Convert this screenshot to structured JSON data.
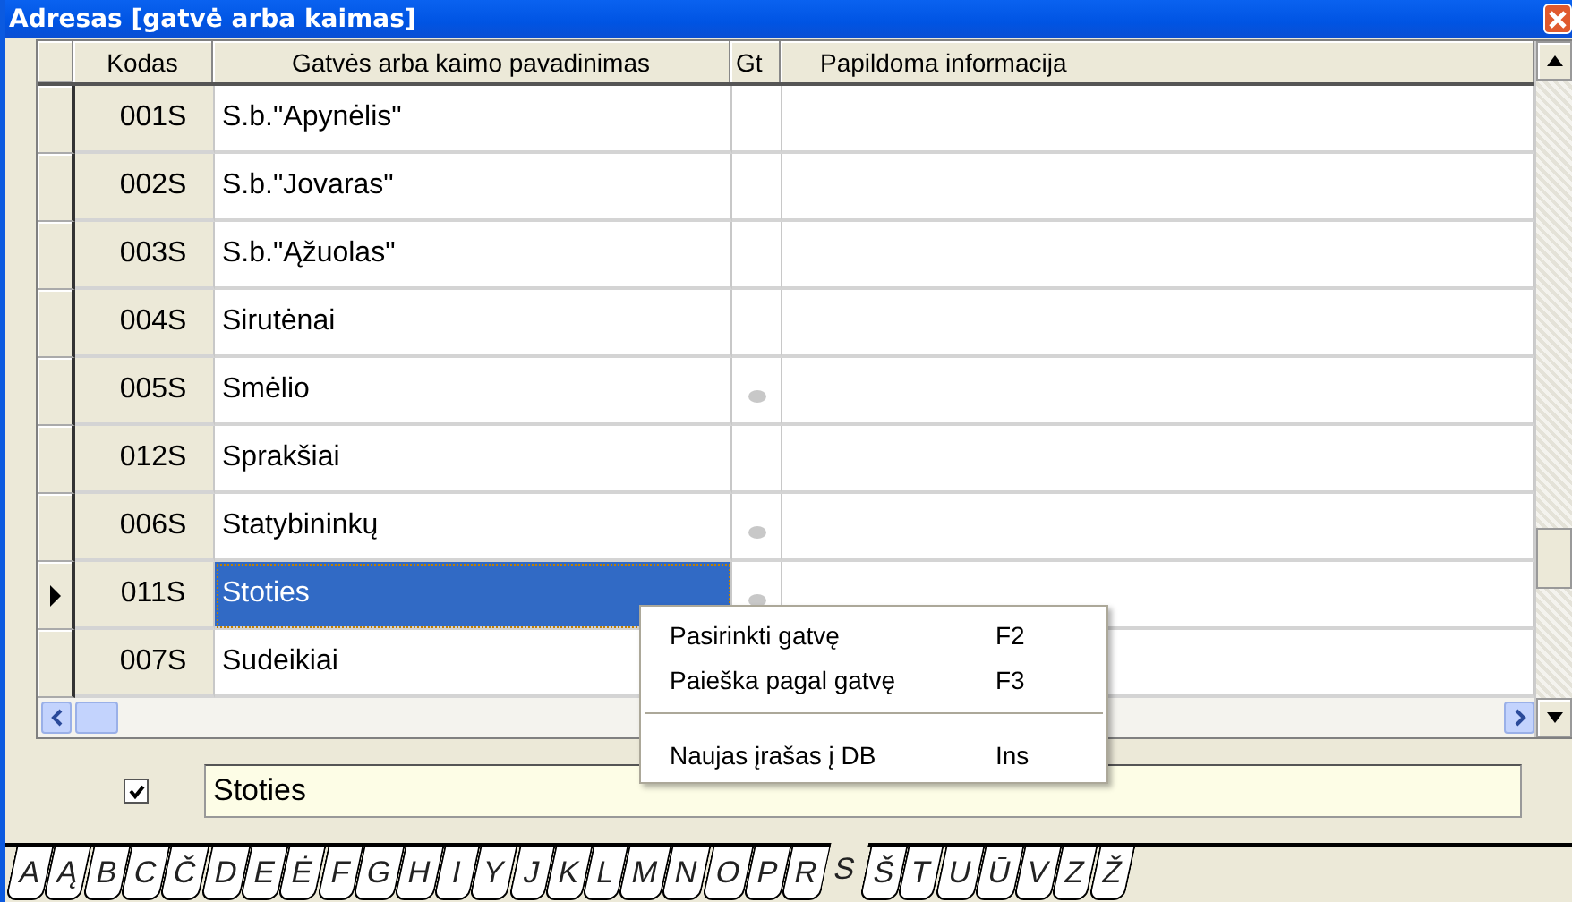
{
  "window": {
    "title": "Adresas [gatvė arba kaimas]"
  },
  "table": {
    "columns": [
      "Kodas",
      "Gatvės arba kaimo pavadinimas",
      "Gt",
      "Papildoma informacija"
    ],
    "rows": [
      {
        "code": "001S",
        "name": "S.b.\"Apynėlis\"",
        "gt": false,
        "selected": false
      },
      {
        "code": "002S",
        "name": "S.b.\"Jovaras\"",
        "gt": false,
        "selected": false
      },
      {
        "code": "003S",
        "name": "S.b.\"Ąžuolas\"",
        "gt": false,
        "selected": false
      },
      {
        "code": "004S",
        "name": "Sirutėnai",
        "gt": false,
        "selected": false
      },
      {
        "code": "005S",
        "name": "Smėlio",
        "gt": true,
        "selected": false
      },
      {
        "code": "012S",
        "name": "Sprakšiai",
        "gt": false,
        "selected": false
      },
      {
        "code": "006S",
        "name": "Statybininkų",
        "gt": true,
        "selected": false
      },
      {
        "code": "011S",
        "name": "Stoties",
        "gt": true,
        "selected": true
      },
      {
        "code": "007S",
        "name": "Sudeikiai",
        "selected": false
      }
    ]
  },
  "context_menu": {
    "items": [
      {
        "kind": "item",
        "label": "Pasirinkti gatvę",
        "shortcut": "F2"
      },
      {
        "kind": "item",
        "label": "Paieška pagal gatvę",
        "shortcut": "F3"
      },
      {
        "kind": "separator"
      },
      {
        "kind": "item",
        "label": "Naujas įrašas į DB",
        "shortcut": "Ins"
      }
    ]
  },
  "filter": {
    "checked": true,
    "value": "Stoties"
  },
  "letter_tabs": [
    {
      "label": "A",
      "selected": false
    },
    {
      "label": "Ą",
      "selected": false
    },
    {
      "label": "B",
      "selected": false
    },
    {
      "label": "C",
      "selected": false
    },
    {
      "label": "Č",
      "selected": false
    },
    {
      "label": "D",
      "selected": false
    },
    {
      "label": "E",
      "selected": false
    },
    {
      "label": "Ė",
      "selected": false
    },
    {
      "label": "F",
      "selected": false
    },
    {
      "label": "G",
      "selected": false
    },
    {
      "label": "H",
      "selected": false
    },
    {
      "label": "I",
      "selected": false
    },
    {
      "label": "Y",
      "selected": false
    },
    {
      "label": "J",
      "selected": false
    },
    {
      "label": "K",
      "selected": false
    },
    {
      "label": "L",
      "selected": false
    },
    {
      "label": "M",
      "selected": false
    },
    {
      "label": "N",
      "selected": false
    },
    {
      "label": "O",
      "selected": false
    },
    {
      "label": "P",
      "selected": false
    },
    {
      "label": "R",
      "selected": false
    },
    {
      "label": "S",
      "selected": true
    },
    {
      "label": "Š",
      "selected": false
    },
    {
      "label": "T",
      "selected": false
    },
    {
      "label": "U",
      "selected": false
    },
    {
      "label": "Ū",
      "selected": false
    },
    {
      "label": "V",
      "selected": false
    },
    {
      "label": "Z",
      "selected": false
    },
    {
      "label": "Ž",
      "selected": false
    }
  ]
}
